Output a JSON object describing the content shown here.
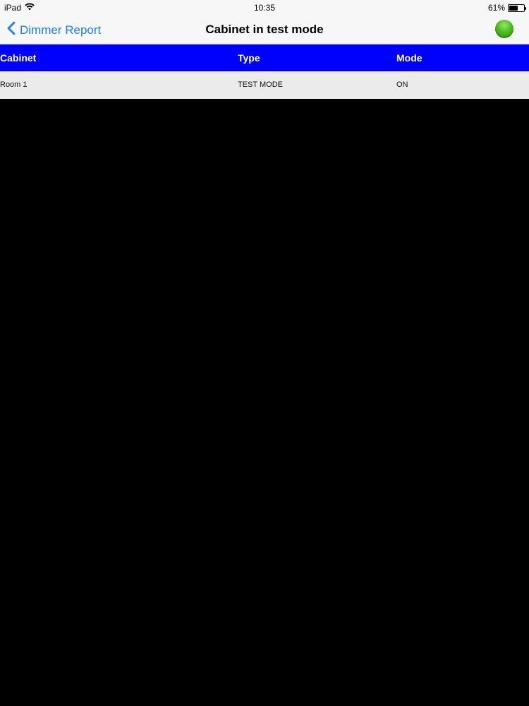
{
  "status_bar": {
    "device": "iPad",
    "time": "10:35",
    "battery": "61%",
    "battery_level": 0.61,
    "wifi_icon": "wifi-icon",
    "battery_icon": "battery-icon"
  },
  "nav": {
    "back_label": "Dimmer Report",
    "back_icon": "chevron-left-icon",
    "title": "Cabinet in test mode",
    "status_indicator_color": "#4bbf1e"
  },
  "table": {
    "header_color": "#0000ff",
    "columns": [
      "Cabinet",
      "Type",
      "Mode"
    ],
    "rows": [
      {
        "cabinet": "Room 1",
        "type": "TEST MODE",
        "mode": "ON"
      }
    ]
  }
}
